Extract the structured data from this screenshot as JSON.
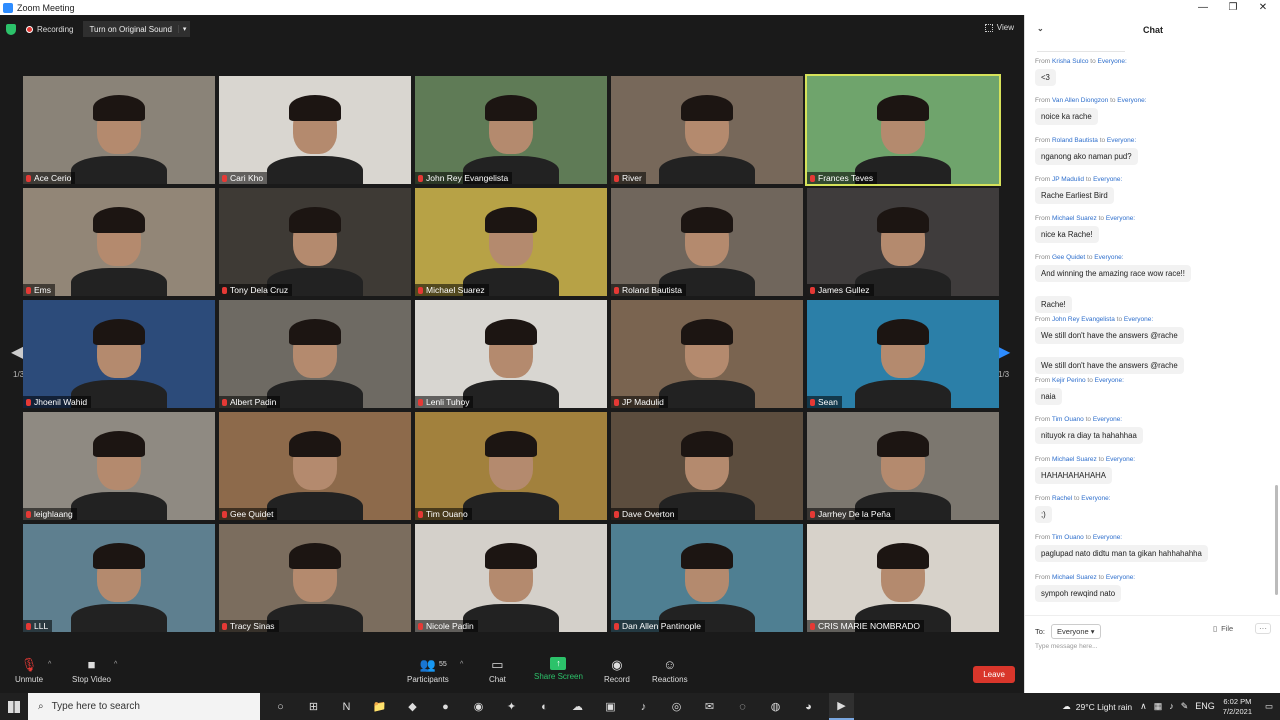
{
  "window": {
    "title": "Zoom Meeting",
    "controls": [
      "—",
      "❐",
      "✕"
    ]
  },
  "top_bar": {
    "recording_label": "Recording",
    "sound_button_label": "Turn on Original Sound",
    "view_label": "View"
  },
  "pagination": {
    "left": "1/3",
    "right": "1/3"
  },
  "participants": [
    {
      "name": "Ace Cerio",
      "bg": "#8a8378"
    },
    {
      "name": "Cari Kho",
      "bg": "#d9d6d0"
    },
    {
      "name": "John Rey Evangelista",
      "bg": "#5f7b56"
    },
    {
      "name": "River",
      "bg": "#77685a"
    },
    {
      "name": "Frances Teves",
      "bg": "#6fa46c",
      "active": true
    },
    {
      "name": "Ems",
      "bg": "#928677"
    },
    {
      "name": "Tony Dela Cruz",
      "bg": "#3e3a35"
    },
    {
      "name": "Michael Suarez",
      "bg": "#b7a246"
    },
    {
      "name": "Roland Bautista",
      "bg": "#70665c"
    },
    {
      "name": "James Gullez",
      "bg": "#3f3c3c"
    },
    {
      "name": "Jhoenil Wahid",
      "bg": "#2c4b7a"
    },
    {
      "name": "Albert Padin",
      "bg": "#6e6a63"
    },
    {
      "name": "Lenli Tuhoy",
      "bg": "#d8d6d1"
    },
    {
      "name": "JP Madulid",
      "bg": "#7a6450"
    },
    {
      "name": "Sean",
      "bg": "#2b7fa8"
    },
    {
      "name": "leighlaang",
      "bg": "#8f8a82"
    },
    {
      "name": "Gee Quidet",
      "bg": "#8d6a4b"
    },
    {
      "name": "Tim Ouano",
      "bg": "#a2813d"
    },
    {
      "name": "Dave Overton",
      "bg": "#5c4d3e"
    },
    {
      "name": "Jarrhey De la Peña",
      "bg": "#7c776f"
    },
    {
      "name": "LLL",
      "bg": "#5e7f8f"
    },
    {
      "name": "Tracy Sinas",
      "bg": "#7b6d5e"
    },
    {
      "name": "Nicole Padin",
      "bg": "#d4d0ca"
    },
    {
      "name": "Dan Allen Pantinople",
      "bg": "#4f7f92"
    },
    {
      "name": "CRIS MARIE NOMBRADO",
      "bg": "#d7d2ca"
    }
  ],
  "toolbar": {
    "unmute": "Unmute",
    "stop_video": "Stop Video",
    "participants": "Participants",
    "participant_count": "55",
    "chat": "Chat",
    "share_screen": "Share Screen",
    "record": "Record",
    "reactions": "Reactions",
    "leave": "Leave"
  },
  "chat": {
    "title": "Chat",
    "from_label": "From",
    "to_label": "to",
    "everyone": "Everyone:",
    "messages": [
      {
        "from": "Krisha Sulco",
        "text": "<3"
      },
      {
        "from": "Van Allen Diongzon",
        "text": "noice ka rache"
      },
      {
        "from": "Roland Bautista",
        "text": "nganong ako naman pud?"
      },
      {
        "from": "JP Madulid",
        "text": "Rache Earliest Bird"
      },
      {
        "from": "Michael Suarez",
        "text": "nice ka Rache!"
      },
      {
        "from": "Gee Quidet",
        "text": "And winning the amazing race wow race!!",
        "followups": [
          "Rache!"
        ]
      },
      {
        "from": "John Rey Evangelista",
        "text": "We still don't have the answers @rache",
        "followups": [
          "We still don't have the answers @rache"
        ]
      },
      {
        "from": "Kejir Perino",
        "text": "naia"
      },
      {
        "from": "Tim Ouano",
        "text": "nituyok ra diay ta hahahhaa"
      },
      {
        "from": "Michael Suarez",
        "text": "HAHAHAHAHAHA"
      },
      {
        "from": "Rachel",
        "text": ";)"
      },
      {
        "from": "Tim Ouano",
        "text": "paglupad nato didtu man ta gikan hahhahahha"
      },
      {
        "from": "Michael Suarez",
        "text": "sympoh rewqind nato"
      }
    ],
    "to_prefix": "To:",
    "recipient": "Everyone",
    "file_label": "File",
    "input_placeholder": "Type message here..."
  },
  "taskbar": {
    "search_placeholder": "Type here to search",
    "apps": [
      "○",
      "⊞",
      "N",
      "📁",
      "◆",
      "●",
      "◉",
      "✦",
      "◐",
      "☁",
      "▣",
      "♪",
      "◎",
      "✉",
      "◌",
      "◍",
      "◕",
      "▶"
    ],
    "weather": "29°C  Light rain",
    "language": "ENG",
    "time": "6:02 PM",
    "date": "7/2/2021"
  }
}
